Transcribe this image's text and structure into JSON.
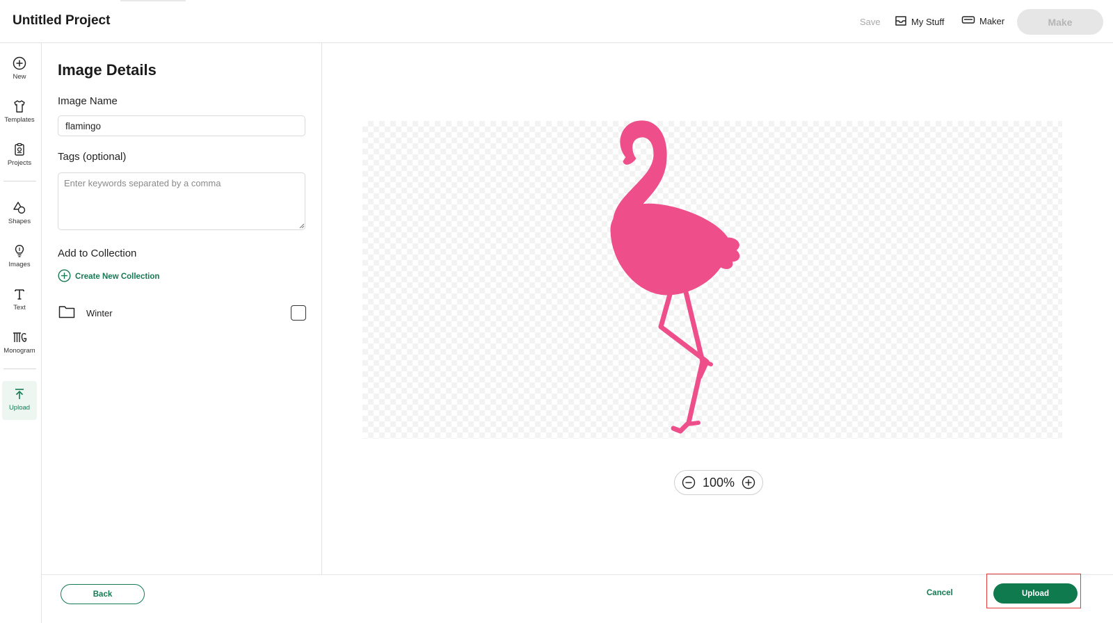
{
  "header": {
    "project_title": "Untitled Project",
    "save_label": "Save",
    "my_stuff_label": "My Stuff",
    "maker_label": "Maker",
    "make_label": "Make"
  },
  "rail": {
    "items": [
      {
        "label": "New",
        "icon": "plus-circle-icon"
      },
      {
        "label": "Templates",
        "icon": "tshirt-icon"
      },
      {
        "label": "Projects",
        "icon": "clipboard-icon"
      },
      {
        "label": "Shapes",
        "icon": "shapes-icon"
      },
      {
        "label": "Images",
        "icon": "bulb-icon"
      },
      {
        "label": "Text",
        "icon": "text-icon"
      },
      {
        "label": "Monogram",
        "icon": "monogram-icon"
      },
      {
        "label": "Upload",
        "icon": "upload-icon",
        "active": true
      }
    ]
  },
  "panel": {
    "title": "Image Details",
    "image_name_label": "Image Name",
    "image_name_value": "flamingo",
    "tags_label": "Tags (optional)",
    "tags_placeholder": "Enter keywords separated by a comma",
    "collection_label": "Add to Collection",
    "create_collection_label": "Create New Collection",
    "collections": [
      {
        "name": "Winter",
        "checked": false
      }
    ]
  },
  "canvas": {
    "zoom_value": "100%",
    "image_color": "#ee4f8b"
  },
  "footer": {
    "back_label": "Back",
    "cancel_label": "Cancel",
    "upload_label": "Upload"
  },
  "colors": {
    "accent_green": "#107a4f",
    "highlight_red": "#e23b3b"
  }
}
